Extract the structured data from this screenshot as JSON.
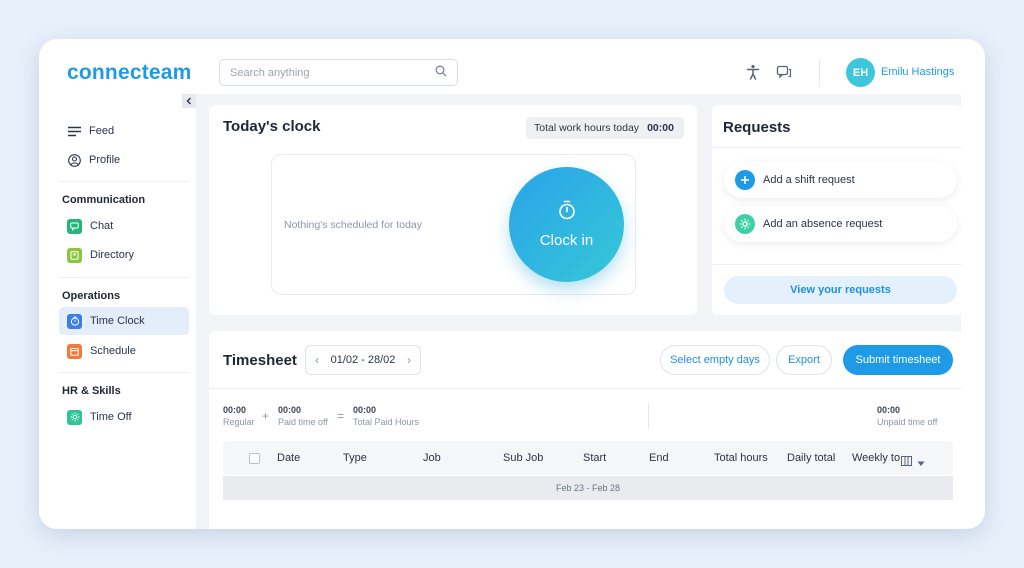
{
  "brand": {
    "logo": "connecteam",
    "accent": "#1f9ae6"
  },
  "search": {
    "placeholder": "Search anything"
  },
  "user": {
    "initials": "EH",
    "name": "Emilu Hastings"
  },
  "sidebar": {
    "top_items": [
      {
        "label": "Feed",
        "icon": "menu-icon"
      },
      {
        "label": "Profile",
        "icon": "user-circle-icon"
      }
    ],
    "sections": [
      {
        "title": "Communication",
        "items": [
          {
            "label": "Chat",
            "icon": "chat-icon"
          },
          {
            "label": "Directory",
            "icon": "directory-icon"
          }
        ]
      },
      {
        "title": "Operations",
        "items": [
          {
            "label": "Time Clock",
            "icon": "stopwatch-icon",
            "active": true
          },
          {
            "label": "Schedule",
            "icon": "calendar-icon"
          }
        ]
      },
      {
        "title": "HR & Skills",
        "items": [
          {
            "label": "Time Off",
            "icon": "sun-icon"
          }
        ]
      }
    ]
  },
  "clock": {
    "title": "Today's clock",
    "total_label": "Total work hours today",
    "total_value": "00:00",
    "empty_text": "Nothing's scheduled for today",
    "clock_in": "Clock in"
  },
  "requests": {
    "title": "Requests",
    "shift": "Add a shift request",
    "absence": "Add an absence request",
    "view": "View your requests"
  },
  "timesheet": {
    "title": "Timesheet",
    "range": "01/02 - 28/02",
    "select_empty": "Select empty days",
    "export": "Export",
    "submit": "Submit timesheet",
    "summary": {
      "regular": {
        "value": "00:00",
        "label": "Regular"
      },
      "paid_off": {
        "value": "00:00",
        "label": "Paid time off"
      },
      "total": {
        "value": "00:00",
        "label": "Total Paid Hours"
      },
      "unpaid": {
        "value": "00:00",
        "label": "Unpaid time off"
      }
    },
    "columns": [
      "Date",
      "Type",
      "Job",
      "Sub Job",
      "Start",
      "End",
      "Total hours",
      "Daily total",
      "Weekly to"
    ],
    "week_label": "Feb 23 - Feb 28"
  }
}
